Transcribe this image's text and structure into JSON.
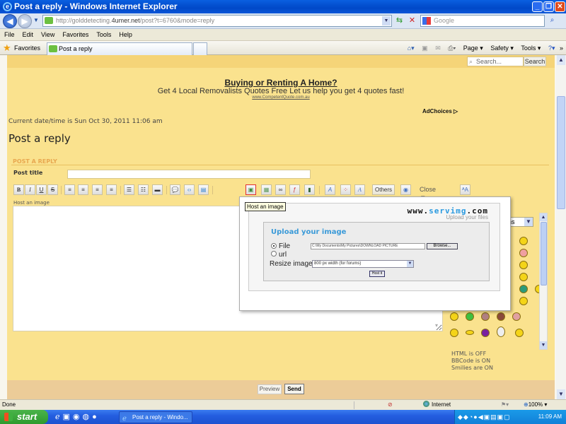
{
  "window": {
    "title": "Post a reply - Windows Internet Explorer",
    "controls": [
      "minimize",
      "restore",
      "close"
    ]
  },
  "address_bar": {
    "url_prefix": "http://golddetecting.",
    "url_domain": "4umer.net",
    "url_suffix": "/post?t=6760&mode=reply",
    "search_placeholder": "Google"
  },
  "menu": [
    "File",
    "Edit",
    "View",
    "Favorites",
    "Tools",
    "Help"
  ],
  "favorites_bar": {
    "favorites_label": "Favorites",
    "tab_label": "Post a reply",
    "commands": [
      "Page ▾",
      "Safety ▾",
      "Tools ▾"
    ]
  },
  "site": {
    "search_placeholder": "Search...",
    "search_button": "Search",
    "ad": {
      "title": "Buying or Renting A Home?",
      "text": "Get 4 Local Removalists Quotes Free Let us help you get 4 quotes fast!",
      "url": "www.CompetentQuote.com.au",
      "adchoices": "AdChoices ▷"
    },
    "datetime": "Current date/time is Sun Oct 30, 2011 11:06 am",
    "page_title": "Post a reply"
  },
  "form": {
    "section_header": "POST A REPLY",
    "post_title_label": "Post title",
    "post_title_value": "",
    "editor_hint": "Host an image",
    "toolbar": {
      "bold": "B",
      "italic": "I",
      "underline": "U",
      "strike": "S",
      "others": "Others",
      "close_tags": "Close Tags",
      "host_tooltip": "Host an image"
    },
    "smilies_select": "ons",
    "status_lines": [
      "HTML is OFF",
      "BBCode is ON",
      "Smilies are ON"
    ],
    "preview_button": "Preview",
    "send_button": "Send"
  },
  "upload_popup": {
    "logo_prefix": "www.",
    "logo_brand": "servimg",
    "logo_suffix": ".com",
    "subtitle": "Upload your files",
    "title": "Upload your image",
    "file_label": "File",
    "file_value": "C:\\My Documents\\My Pictures\\DOWNLOAD PICTURE",
    "browse_button": "Browse...",
    "url_label": "url",
    "source_selected": "File",
    "resize_label": "Resize image",
    "resize_value": "800 px width (for forums)",
    "host_button": "Host it"
  },
  "statusbar": {
    "status": "Done",
    "zone": "Internet",
    "zoom": "100%"
  },
  "taskbar": {
    "start": "start",
    "task_label": "Post a reply - Windo...",
    "clock": "11:09 AM"
  }
}
